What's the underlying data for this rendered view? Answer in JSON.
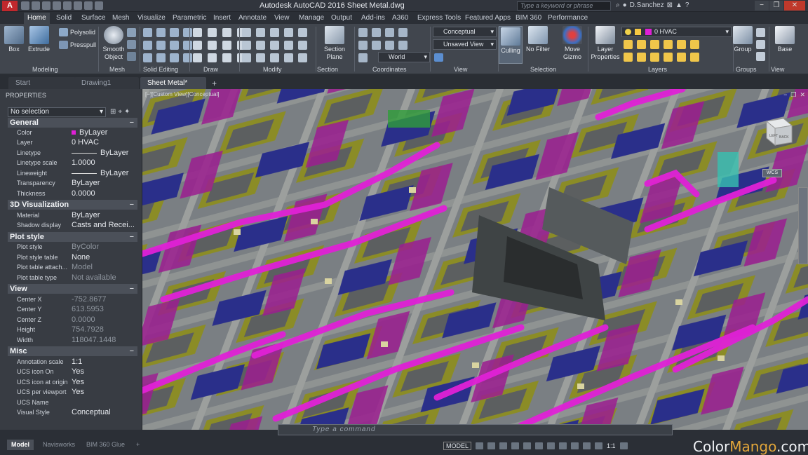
{
  "app": {
    "title": "Autodesk AutoCAD 2016    Sheet Metal.dwg",
    "logo": "A",
    "search_placeholder": "Type a keyword or phrase",
    "user": "D.Sanchez",
    "help": "?"
  },
  "ribbon_tabs": [
    "Home",
    "Solid",
    "Surface",
    "Mesh",
    "Visualize",
    "Parametric",
    "Insert",
    "Annotate",
    "View",
    "Manage",
    "Output",
    "Add-ins",
    "A360",
    "Express Tools",
    "Featured Apps",
    "BIM 360",
    "Performance"
  ],
  "ribbon": {
    "box": "Box",
    "extrude": "Extrude",
    "polysolid": "Polysolid",
    "presspull": "Presspull",
    "smooth_object": "Smooth Object",
    "section_plane": "Section Plane",
    "visual_style": "Conceptual",
    "view_name": "Unsaved View",
    "coord": "World",
    "culling": "Culling",
    "no_filter": "No Filter",
    "move_gizmo": "Move Gizmo",
    "layer_properties": "Layer Properties",
    "layer_combo": "0 HVAC",
    "group": "Group",
    "base": "Base",
    "panels": {
      "modeling": "Modeling",
      "mesh": "Mesh",
      "solid_editing": "Solid Editing",
      "draw": "Draw",
      "modify": "Modify",
      "section": "Section",
      "coordinates": "Coordinates",
      "view": "View",
      "selection": "Selection",
      "layers": "Layers",
      "groups": "Groups",
      "view2": "View"
    }
  },
  "doc_tabs": [
    "Start",
    "Drawing1",
    "Sheet Metal*"
  ],
  "properties": {
    "title": "PROPERTIES",
    "selection": "No selection",
    "sections": {
      "general": "General",
      "viz3d": "3D Visualization",
      "plot": "Plot style",
      "view": "View",
      "misc": "Misc"
    },
    "general": [
      {
        "k": "Color",
        "v": "ByLayer"
      },
      {
        "k": "Layer",
        "v": "0 HVAC"
      },
      {
        "k": "Linetype",
        "v": "ByLayer"
      },
      {
        "k": "Linetype scale",
        "v": "1.0000"
      },
      {
        "k": "Lineweight",
        "v": "ByLayer"
      },
      {
        "k": "Transparency",
        "v": "ByLayer"
      },
      {
        "k": "Thickness",
        "v": "0.0000"
      }
    ],
    "viz3d": [
      {
        "k": "Material",
        "v": "ByLayer"
      },
      {
        "k": "Shadow display",
        "v": "Casts and Recei..."
      }
    ],
    "plot": [
      {
        "k": "Plot style",
        "v": "ByColor"
      },
      {
        "k": "Plot style table",
        "v": "None"
      },
      {
        "k": "Plot table attach...",
        "v": "Model"
      },
      {
        "k": "Plot table type",
        "v": "Not available"
      }
    ],
    "view": [
      {
        "k": "Center X",
        "v": "-752.8677"
      },
      {
        "k": "Center Y",
        "v": "613.5953"
      },
      {
        "k": "Center Z",
        "v": "0.0000"
      },
      {
        "k": "Height",
        "v": "754.7928"
      },
      {
        "k": "Width",
        "v": "118047.1448"
      }
    ],
    "misc": [
      {
        "k": "Annotation scale",
        "v": "1:1"
      },
      {
        "k": "UCS icon On",
        "v": "Yes"
      },
      {
        "k": "UCS icon at origin",
        "v": "Yes"
      },
      {
        "k": "UCS per viewport",
        "v": "Yes"
      },
      {
        "k": "UCS Name",
        "v": ""
      },
      {
        "k": "Visual Style",
        "v": "Conceptual"
      }
    ]
  },
  "viewport": {
    "label": "[−][Custom View][Conceptual]",
    "wcs": "WCS",
    "cube_face": "LEFT",
    "cube_face2": "BACK"
  },
  "command": {
    "placeholder": "Type a command"
  },
  "layout_tabs": [
    "Model",
    "Navisworks",
    "BIM 360 Glue"
  ],
  "status": {
    "model": "MODEL",
    "scale": "1:1"
  },
  "watermark": {
    "a": "Color",
    "b": "Mango",
    "c": ".com"
  },
  "colors": {
    "accent": "#e01fd7",
    "olive": "#8a8c23",
    "navy": "#2a2f8a"
  }
}
